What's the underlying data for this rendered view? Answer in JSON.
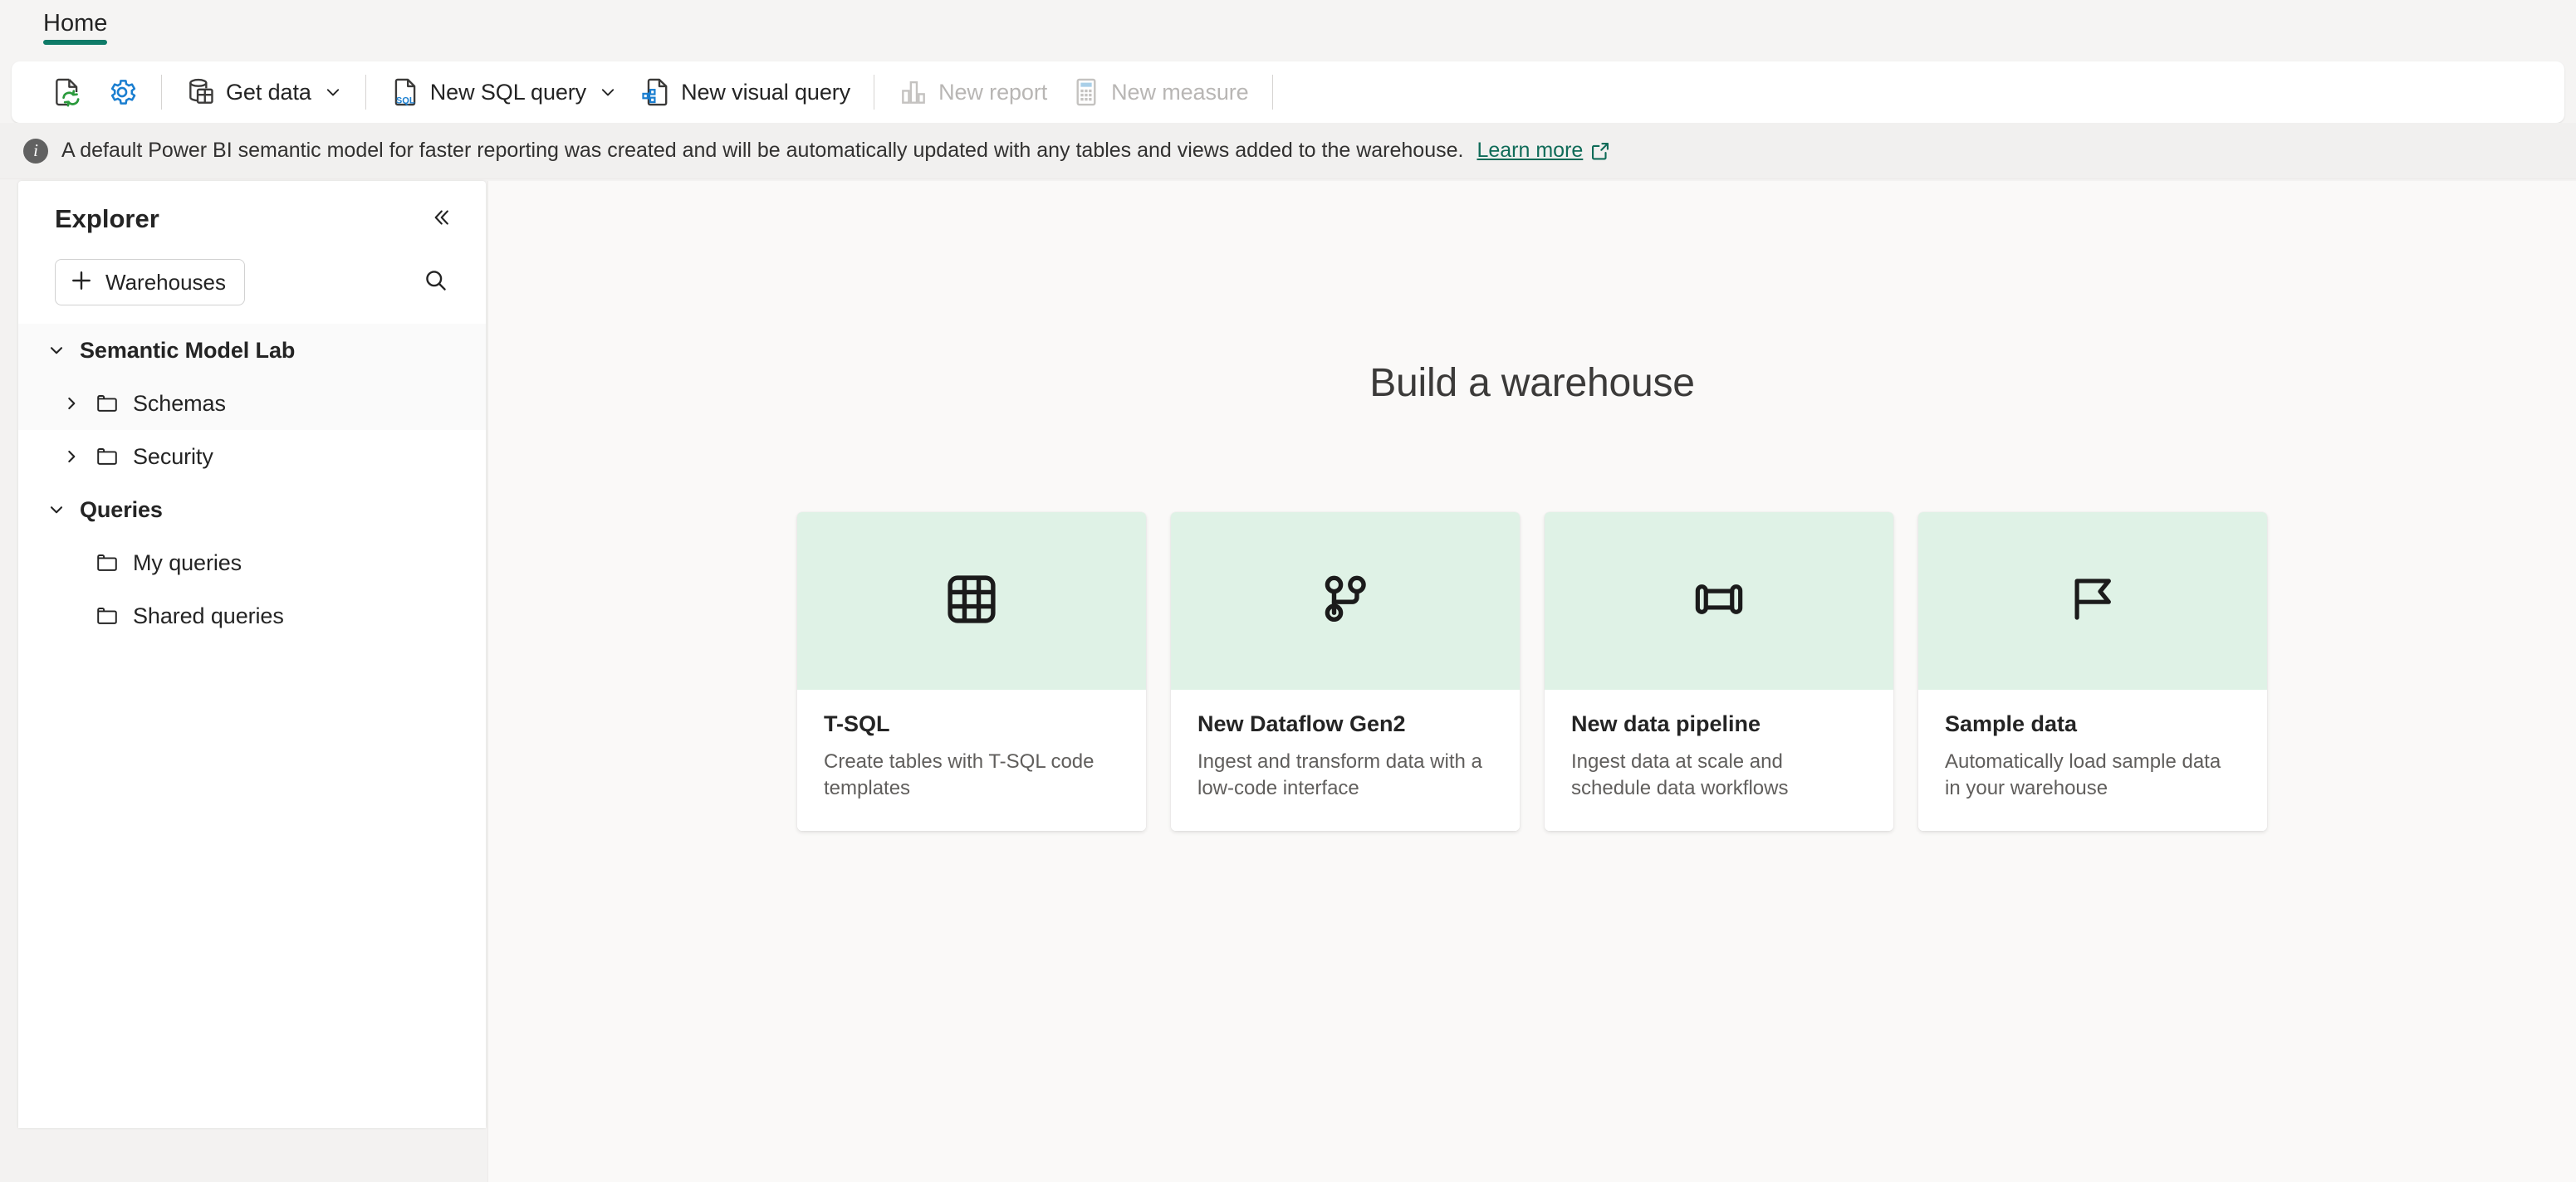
{
  "tabs": [
    {
      "label": "Home",
      "active": true,
      "accent": "#0f7b68"
    }
  ],
  "toolbar": {
    "items": [
      {
        "name": "refresh-document",
        "label": "",
        "icon": "refresh-document-icon",
        "disabled": false,
        "chevron": false
      },
      {
        "name": "settings",
        "label": "",
        "icon": "gear-icon",
        "disabled": false,
        "chevron": false
      },
      {
        "name": "get-data",
        "label": "Get data",
        "icon": "database-table-icon",
        "disabled": false,
        "chevron": true
      },
      {
        "name": "new-sql-query",
        "label": "New SQL query",
        "icon": "sql-document-icon",
        "disabled": false,
        "chevron": true
      },
      {
        "name": "new-visual-query",
        "label": "New visual query",
        "icon": "visual-query-document-icon",
        "disabled": false,
        "chevron": false
      },
      {
        "name": "new-report",
        "label": "New report",
        "icon": "bar-chart-icon",
        "disabled": true,
        "chevron": false
      },
      {
        "name": "new-measure",
        "label": "New measure",
        "icon": "calculator-icon",
        "disabled": true,
        "chevron": false
      }
    ]
  },
  "infobar": {
    "icon": "info-icon",
    "message": "A default Power BI semantic model for faster reporting was created and will be automatically updated with any tables and views added to the warehouse.",
    "link_label": "Learn more",
    "link_icon": "external-link-icon",
    "link_color": "#0f6b58"
  },
  "sidebar": {
    "title": "Explorer",
    "collapse_icon": "chevron-double-left-icon",
    "add_button": {
      "label": "Warehouses",
      "icon": "plus-icon"
    },
    "search_icon": "search-icon",
    "tree": [
      {
        "label": "Semantic Model Lab",
        "level": 0,
        "expanded": true,
        "chevron": "chevron-down-icon",
        "folder": false,
        "highlight": true
      },
      {
        "label": "Schemas",
        "level": 1,
        "expanded": false,
        "chevron": "chevron-right-icon",
        "folder": true,
        "highlight": true
      },
      {
        "label": "Security",
        "level": 1,
        "expanded": false,
        "chevron": "chevron-right-icon",
        "folder": true,
        "highlight": false
      },
      {
        "label": "Queries",
        "level": 0,
        "expanded": true,
        "chevron": "chevron-down-icon",
        "folder": false,
        "highlight": false
      },
      {
        "label": "My queries",
        "level": 2,
        "expanded": null,
        "chevron": "",
        "folder": true,
        "highlight": false
      },
      {
        "label": "Shared queries",
        "level": 2,
        "expanded": null,
        "chevron": "",
        "folder": true,
        "highlight": false
      }
    ]
  },
  "main": {
    "heading": "Build a warehouse",
    "cards": [
      {
        "title": "T-SQL",
        "desc": "Create tables with T-SQL code templates",
        "icon": "table-grid-icon",
        "art_color": "#dff2e6"
      },
      {
        "title": "New Dataflow Gen2",
        "desc": "Ingest and transform data with a low-code interface",
        "icon": "dataflow-branch-icon",
        "art_color": "#dff2e6"
      },
      {
        "title": "New data pipeline",
        "desc": "Ingest data at scale and schedule data workflows",
        "icon": "pipeline-icon",
        "art_color": "#dff2e6"
      },
      {
        "title": "Sample data",
        "desc": "Automatically load sample data in your warehouse",
        "icon": "flag-icon",
        "art_color": "#dff2e6"
      }
    ]
  }
}
